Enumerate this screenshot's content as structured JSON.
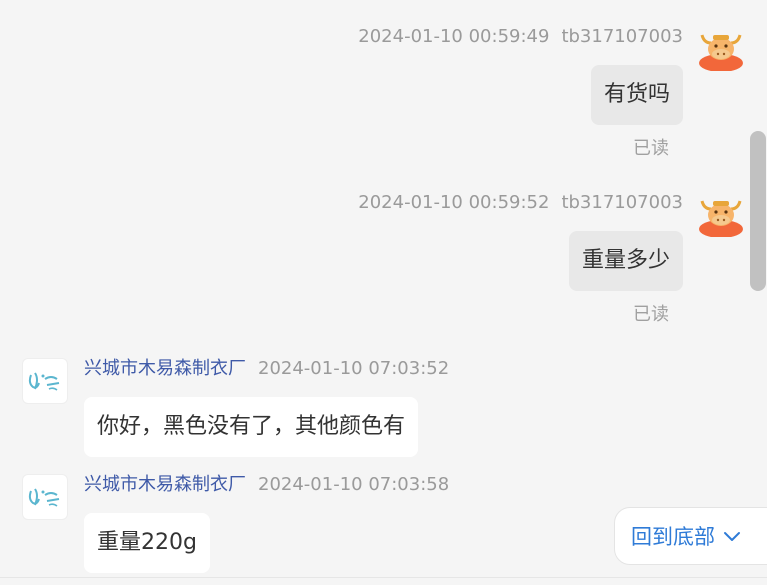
{
  "messages": [
    {
      "direction": "out",
      "timestamp": "2024-01-10 00:59:49",
      "sender": "tb317107003",
      "text": "有货吗",
      "status": "已读",
      "avatar_icon": "bull-avatar-icon"
    },
    {
      "direction": "out",
      "timestamp": "2024-01-10 00:59:52",
      "sender": "tb317107003",
      "text": "重量多少",
      "status": "已读",
      "avatar_icon": "bull-avatar-icon"
    },
    {
      "direction": "in",
      "sender": "兴城市木易森制衣厂",
      "timestamp": "2024-01-10 07:03:52",
      "text": "你好，黑色没有了，其他颜色有",
      "avatar_icon": "shop-logo-icon"
    },
    {
      "direction": "in",
      "sender": "兴城市木易森制衣厂",
      "timestamp": "2024-01-10 07:03:58",
      "text": "重量220g",
      "avatar_icon": "shop-logo-icon"
    }
  ],
  "scroll_to_bottom": {
    "label": "回到底部",
    "icon": "chevron-down-icon"
  },
  "colors": {
    "background": "#f5f5f5",
    "outgoing_bubble": "#e8e8e8",
    "incoming_bubble": "#ffffff",
    "shop_name": "#3f5aa8",
    "accent": "#2f7bd7"
  }
}
